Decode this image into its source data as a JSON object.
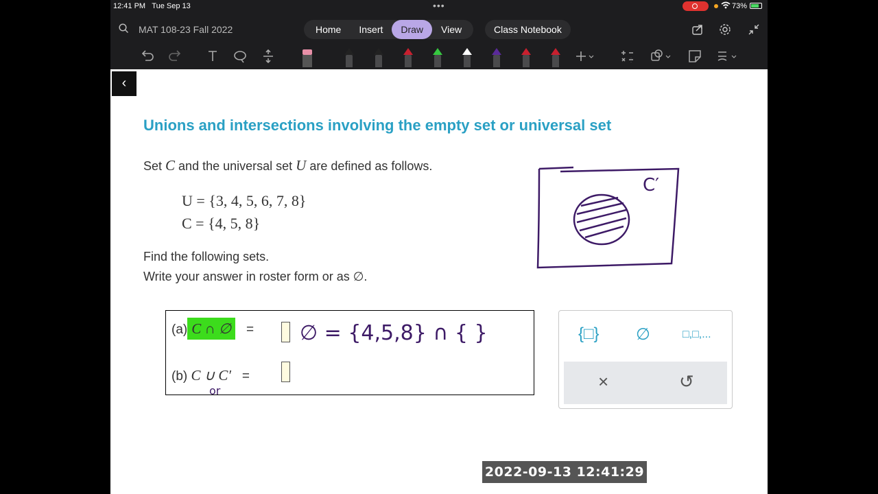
{
  "status_bar": {
    "time": "12:41 PM",
    "date": "Tue Sep 13",
    "battery": "73%"
  },
  "header": {
    "doc_title": "MAT 108-23 Fall 2022",
    "tabs": [
      {
        "label": "Home",
        "active": false
      },
      {
        "label": "Insert",
        "active": false
      },
      {
        "label": "Draw",
        "active": true
      },
      {
        "label": "View",
        "active": false
      }
    ],
    "class_notebook": "Class Notebook",
    "right_icons": [
      "share-icon",
      "gear-icon",
      "collapse-icon"
    ]
  },
  "toolbar": {
    "tools": [
      "undo-icon",
      "redo-icon",
      "text-tool-icon",
      "lasso-icon",
      "insert-space-icon",
      "eraser-icon"
    ],
    "pens": [
      {
        "color": "#222222"
      },
      {
        "color": "#222222"
      },
      {
        "color": "#c8202f"
      },
      {
        "color": "#36c840"
      },
      {
        "color": "#ffffff"
      },
      {
        "color": "#5a2a99"
      },
      {
        "color": "#c8202f"
      },
      {
        "color": "#c8202f"
      }
    ],
    "extra": [
      "add-pen-icon",
      "ink-to-math-icon",
      "shapes-icon",
      "sticky-icon",
      "ink-tools-icon"
    ]
  },
  "content": {
    "heading": "Unions and intersections involving the empty set or universal set",
    "intro_pre": "Set ",
    "intro_c": "C",
    "intro_mid": " and the universal set ",
    "intro_u": "U",
    "intro_post": " are defined as follows.",
    "eq_u": "U = {3, 4, 5, 6, 7, 8}",
    "eq_c": "C = {4, 5, 8}",
    "find": "Find the following sets.",
    "write": "Write your answer in roster form or as ∅.",
    "part_a_label": "(a)",
    "part_a_expr": "C ∩ ∅",
    "part_a_equals": "=",
    "part_b_label": "(b)",
    "part_b_expr": "C ∪ C′",
    "part_b_equals": "="
  },
  "keypad": {
    "keys": [
      "{□}",
      "∅",
      "□,□,..."
    ],
    "clear": "×",
    "undo": "↺"
  },
  "ink": {
    "venn_label": "C′",
    "work": "∅ = {4,5,8} ∩ { }",
    "note": "or"
  },
  "timestamp": "2022-09-13  12:41:29"
}
